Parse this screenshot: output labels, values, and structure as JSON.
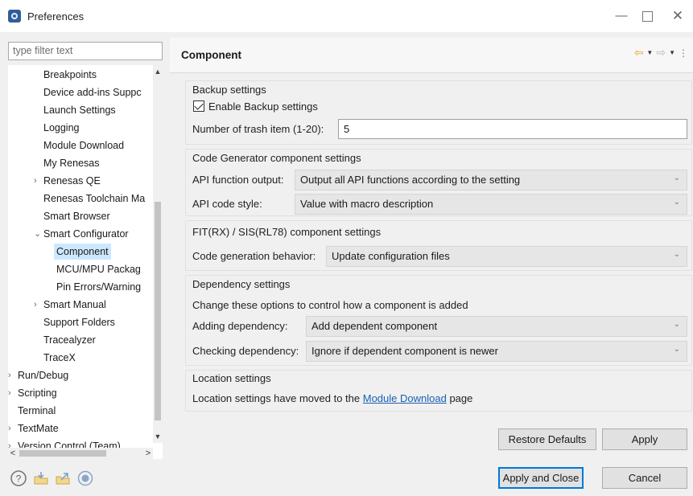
{
  "window": {
    "title": "Preferences",
    "min_glyph": "—",
    "close_glyph": "✕"
  },
  "left": {
    "filter_placeholder": "type filter text",
    "tree": [
      {
        "label": "Breakpoints",
        "arrow": ""
      },
      {
        "label": "Device add-ins Suppc",
        "arrow": ""
      },
      {
        "label": "Launch Settings",
        "arrow": ""
      },
      {
        "label": "Logging",
        "arrow": ""
      },
      {
        "label": "Module Download",
        "arrow": ""
      },
      {
        "label": "My Renesas",
        "arrow": ""
      },
      {
        "label": "Renesas QE",
        "arrow": "›"
      },
      {
        "label": "Renesas Toolchain Ma",
        "arrow": ""
      },
      {
        "label": "Smart Browser",
        "arrow": ""
      },
      {
        "label": "Smart Configurator",
        "arrow": "⌄"
      },
      {
        "label": "Component",
        "arrow": ""
      },
      {
        "label": "MCU/MPU Packag",
        "arrow": ""
      },
      {
        "label": "Pin Errors/Warning",
        "arrow": ""
      },
      {
        "label": "Smart Manual",
        "arrow": "›"
      },
      {
        "label": "Support Folders",
        "arrow": ""
      },
      {
        "label": "Tracealyzer",
        "arrow": ""
      },
      {
        "label": "TraceX",
        "arrow": ""
      },
      {
        "label": "Run/Debug",
        "arrow": "›"
      },
      {
        "label": "Scripting",
        "arrow": "›"
      },
      {
        "label": "Terminal",
        "arrow": ""
      },
      {
        "label": "TextMate",
        "arrow": "›"
      },
      {
        "label": "Version Control (Team)",
        "arrow": "›"
      }
    ],
    "scroll_up": "▲",
    "scroll_down": "▼",
    "scroll_left": "<",
    "scroll_right": ">"
  },
  "main": {
    "title": "Component",
    "backup": {
      "section": "Backup settings",
      "enable_label": "Enable Backup settings",
      "enable_checked": true,
      "trash_label": "Number of trash item (1-20):",
      "trash_value": "5"
    },
    "codegen": {
      "section": "Code Generator component settings",
      "api_output_label": "API function output:",
      "api_output_value": "Output all API functions according to the setting",
      "api_style_label": "API code style:",
      "api_style_value": "Value with macro description"
    },
    "fit": {
      "section": "FIT(RX) / SIS(RL78) component settings",
      "behavior_label": "Code generation behavior:",
      "behavior_value": "Update configuration files"
    },
    "dependency": {
      "section": "Dependency settings",
      "description": "Change these options to control how a component is added",
      "adding_label": "Adding dependency:",
      "adding_value": "Add dependent component",
      "checking_label": "Checking dependency:",
      "checking_value": "Ignore if dependent component is newer"
    },
    "location": {
      "section": "Location settings",
      "text_before": "Location settings have moved to the ",
      "link_text": "Module Download",
      "text_after": " page"
    },
    "restore_defaults": "Restore Defaults",
    "apply": "Apply",
    "chevron": "⌄"
  },
  "bottom": {
    "apply_and_close": "Apply and Close",
    "cancel": "Cancel",
    "icons": [
      "help-icon",
      "import-icon",
      "export-icon",
      "record-icon"
    ]
  },
  "colors": {
    "selected_bg": "#cce8ff",
    "link": "#1a5fb4",
    "default_button_border": "#0078d7",
    "nav_back": "#e8a227"
  }
}
